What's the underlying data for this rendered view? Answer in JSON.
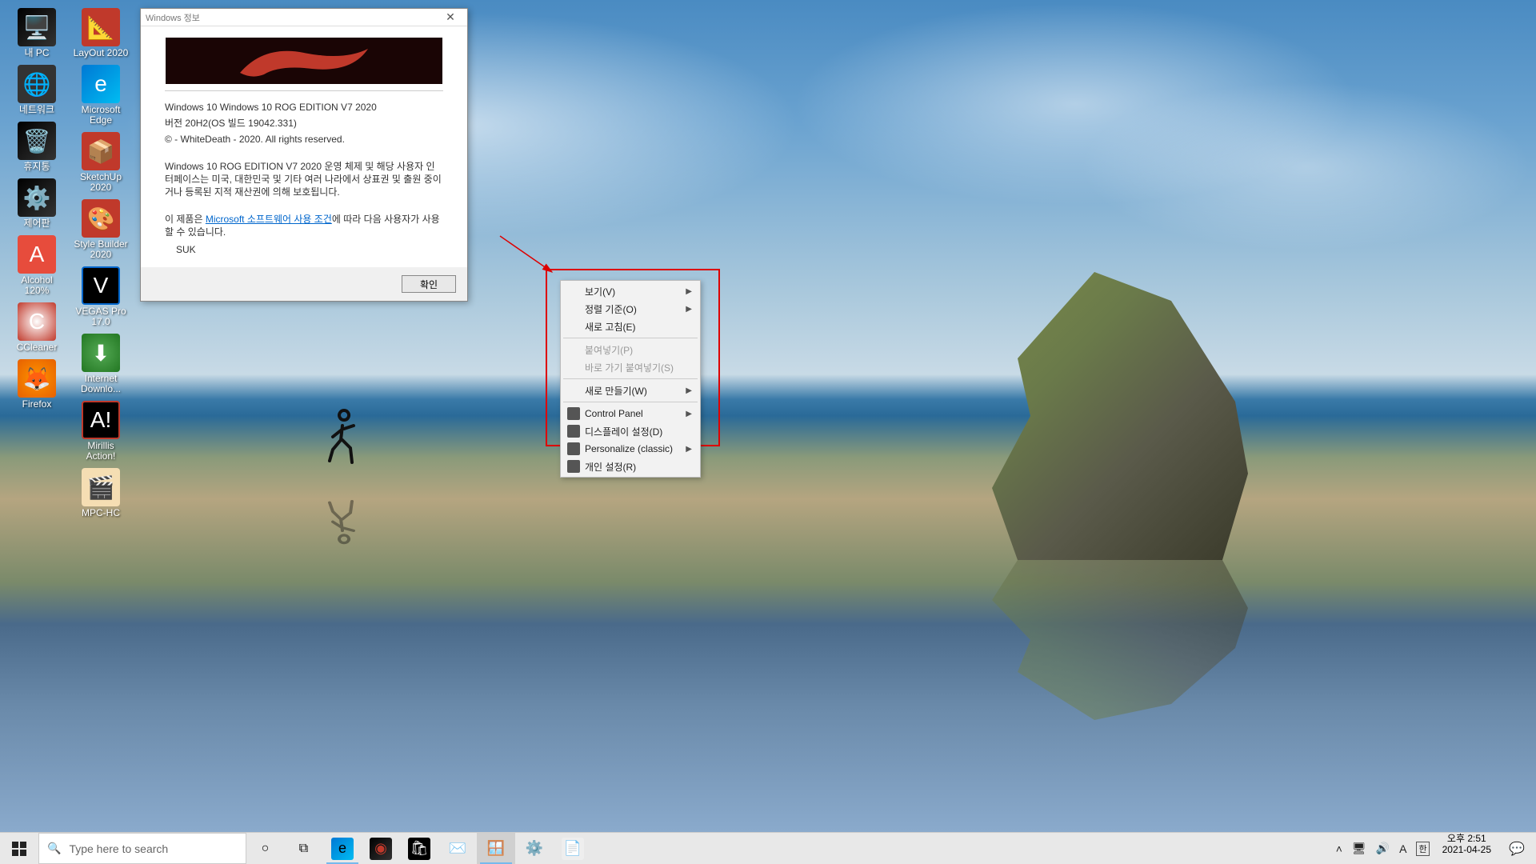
{
  "desktop": {
    "icons_col1": [
      {
        "label": "내 PC"
      },
      {
        "label": "네트워크"
      },
      {
        "label": "휴지통"
      },
      {
        "label": "제어판"
      },
      {
        "label": "Alcohol 120%"
      },
      {
        "label": "CCleaner"
      },
      {
        "label": "Firefox"
      }
    ],
    "icons_col2": [
      {
        "label": "LayOut 2020"
      },
      {
        "label": "Microsoft Edge"
      },
      {
        "label": "SketchUp 2020"
      },
      {
        "label": "Style Builder 2020"
      },
      {
        "label": "VEGAS Pro 17.0"
      },
      {
        "label": "Internet Downlo..."
      },
      {
        "label": "Mirillis Action!"
      }
    ],
    "icons_col3": [
      {
        "label": "MPC-HC"
      }
    ]
  },
  "winver": {
    "title": "Windows 정보",
    "line1": "Windows 10 Windows 10 ROG EDITION V7 2020",
    "line2": "버전 20H2(OS 빌드 19042.331)",
    "line3": "© - WhiteDeath - 2020. All rights reserved.",
    "para2": "Windows 10 ROG EDITION V7 2020 운영 체제 및 해당 사용자 인터페이스는 미국, 대한민국 및 기타 여러 나라에서 상표권 및 출원 중이거나 등록된 지적 재산권에 의해 보호됩니다.",
    "para3_a": "이 제품은 ",
    "para3_link": "Microsoft 소프트웨어 사용 조건",
    "para3_b": "에 따라 다음 사용자가 사용할 수 있습니다.",
    "user": "SUK",
    "ok": "확인"
  },
  "context_menu": {
    "items": [
      {
        "label": "보기(V)",
        "arrow": true
      },
      {
        "label": "정렬 기준(O)",
        "arrow": true
      },
      {
        "label": "새로 고침(E)"
      },
      {
        "sep": true
      },
      {
        "label": "붙여넣기(P)",
        "disabled": true
      },
      {
        "label": "바로 가기 붙여넣기(S)",
        "disabled": true
      },
      {
        "sep": true
      },
      {
        "label": "새로 만들기(W)",
        "arrow": true
      },
      {
        "sep": true
      },
      {
        "label": "Control Panel",
        "arrow": true,
        "icon": true
      },
      {
        "label": "디스플레이 설정(D)",
        "icon": true
      },
      {
        "label": "Personalize (classic)",
        "arrow": true,
        "icon": true
      },
      {
        "label": "개인 설정(R)",
        "icon": true
      }
    ]
  },
  "taskbar": {
    "search_placeholder": "Type here to search",
    "time": "오후 2:51",
    "date": "2021-04-25",
    "ime": "A",
    "ime2": "한"
  }
}
